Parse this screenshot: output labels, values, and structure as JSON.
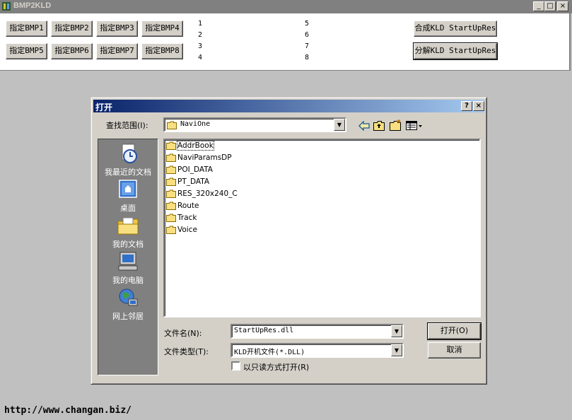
{
  "app": {
    "title": "BMP2KLD",
    "controls": {
      "minimize": "_",
      "maximize": "□",
      "close": "×"
    }
  },
  "toolbar": {
    "bmp_buttons": [
      "指定BMP1",
      "指定BMP2",
      "指定BMP3",
      "指定BMP4",
      "指定BMP5",
      "指定BMP6",
      "指定BMP7",
      "指定BMP8"
    ],
    "numbers_col1": [
      "1",
      "2",
      "3",
      "4"
    ],
    "numbers_col2": [
      "5",
      "6",
      "7",
      "8"
    ],
    "combine_label": "合成KLD StartUpRes",
    "split_label": "分解KLD StartUpRes"
  },
  "dialog": {
    "title": "打开",
    "help_label": "?",
    "close_label": "×",
    "look_in_label": "查找范围(I):",
    "look_in_value": "NaviOne",
    "places": [
      {
        "label": "我最近的文档",
        "icon": "recent-documents-icon"
      },
      {
        "label": "桌面",
        "icon": "desktop-icon"
      },
      {
        "label": "我的文档",
        "icon": "my-documents-icon"
      },
      {
        "label": "我的电脑",
        "icon": "my-computer-icon"
      },
      {
        "label": "网上邻居",
        "icon": "network-places-icon"
      }
    ],
    "files": [
      "AddrBook",
      "NaviParamsDP",
      "POI_DATA",
      "PT_DATA",
      "RES_320x240_C",
      "Route",
      "Track",
      "Voice"
    ],
    "filename_label": "文件名(N):",
    "filename_value": "StartUpRes.dll",
    "filetype_label": "文件类型(T):",
    "filetype_value": "KLD开机文件(*.DLL)",
    "readonly_label": "以只读方式打开(R)",
    "open_button": "打开(O)",
    "cancel_button": "取消"
  },
  "footer": {
    "url": "http://www.changan.biz/"
  }
}
